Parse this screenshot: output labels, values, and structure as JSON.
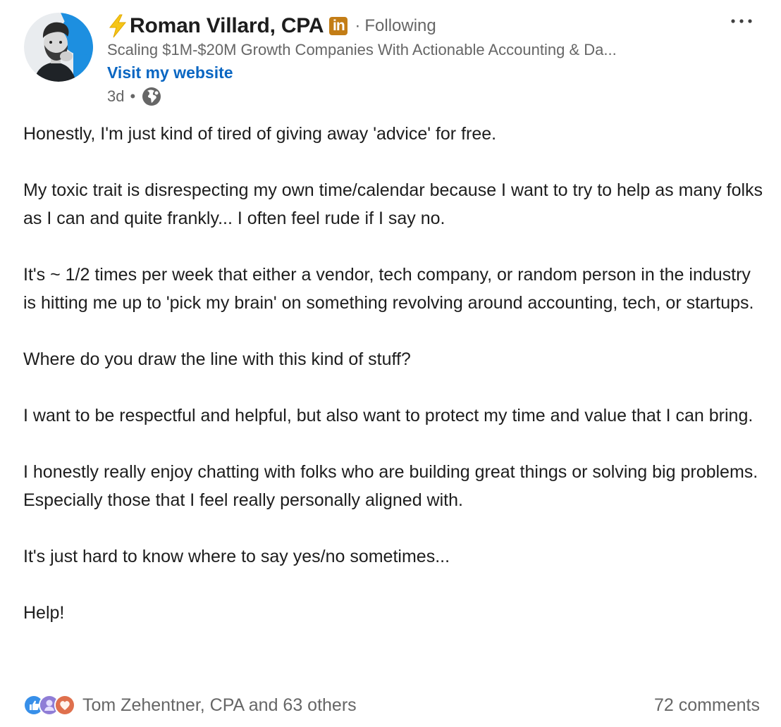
{
  "post": {
    "author": {
      "name": "Roman Villard, CPA",
      "badge": "in",
      "connection": "Following",
      "headline": "Scaling $1M-$20M Growth Companies With Actionable Accounting & Da...",
      "link_label": "Visit my website",
      "time": "3d",
      "visibility_icon": "globe-icon"
    },
    "menu_icon": "more-icon",
    "paragraphs": [
      "Honestly, I'm just kind of tired of giving away 'advice' for free.",
      "My toxic trait is disrespecting my own time/calendar because I want to try to help as many folks as I can and quite frankly... I often feel rude if I say no.",
      "It's ~ 1/2 times per week that either a vendor, tech company, or random person in the industry is hitting me up to 'pick my brain' on something revolving around accounting, tech, or startups.",
      "Where do you draw the line with this kind of stuff?",
      "I want to be respectful and helpful, but also want to protect my time and value that I can bring.",
      "I honestly really enjoy chatting with folks who are building great things or solving big problems. Especially those that I feel really personally aligned with.",
      "It's just hard to know where to say yes/no sometimes...",
      "Help!"
    ],
    "reactions": {
      "icons": [
        "like-icon",
        "insightful-icon",
        "love-icon"
      ],
      "summary": "Tom Zehentner, CPA and 63 others"
    },
    "comments": "72 comments"
  },
  "colors": {
    "link": "#0a66c2",
    "muted": "#666666",
    "text": "#1d1d1d",
    "badge": "#c37d16",
    "avatar_ring": "#1d8fe0"
  }
}
